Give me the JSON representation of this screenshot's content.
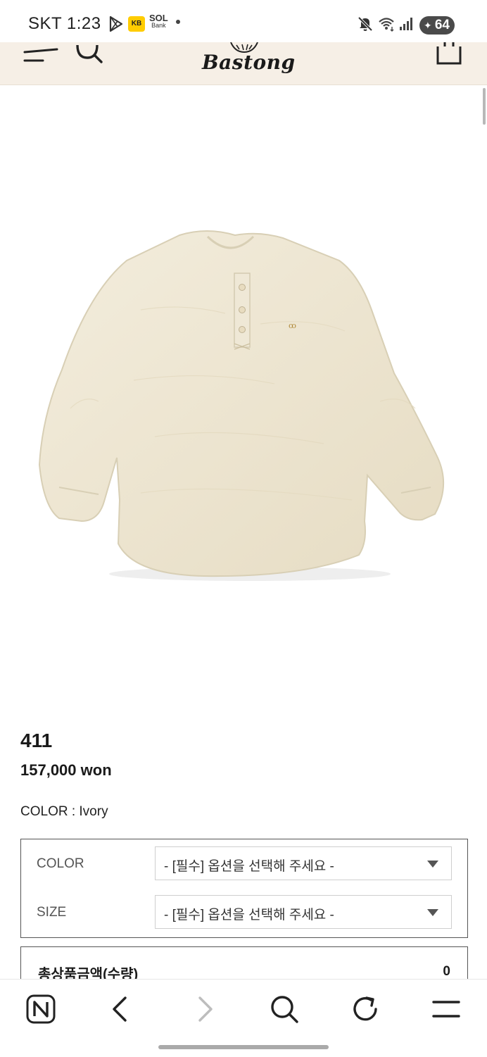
{
  "status_bar": {
    "carrier_time": "SKT 1:23",
    "kb_icon_label": "KB",
    "sol_label_top": "SOL",
    "sol_label_bottom": "Bank",
    "battery": "64",
    "icons": [
      "play-store-icon",
      "kb-app-icon",
      "sol-bank-icon",
      "notification-dot-icon",
      "mute-icon",
      "wifi-icon",
      "signal-icon",
      "battery-icon"
    ]
  },
  "header": {
    "logo_text": "Bastong",
    "icons": [
      "menu-icon",
      "search-icon",
      "logo-emblem",
      "shopping-bag-icon"
    ],
    "background": "#f6efe6"
  },
  "product": {
    "image_description_icon": "ivory-henley-shirt-image",
    "name": "411",
    "price": "157,000 won",
    "color_line": "COLOR : Ivory",
    "garment_color": "#efe8d6"
  },
  "options": [
    {
      "label": "COLOR",
      "placeholder": "- [필수] 옵션을 선택해 주세요 -"
    },
    {
      "label": "SIZE",
      "placeholder": "- [필수] 옵션을 선택해 주세요 -"
    }
  ],
  "total": {
    "label": "총상품금액(수량)",
    "value": "0"
  },
  "browser_bar": {
    "icons": [
      "naver-home-icon",
      "back-icon",
      "forward-icon",
      "search-icon",
      "refresh-icon",
      "hamburger-menu-icon"
    ]
  }
}
